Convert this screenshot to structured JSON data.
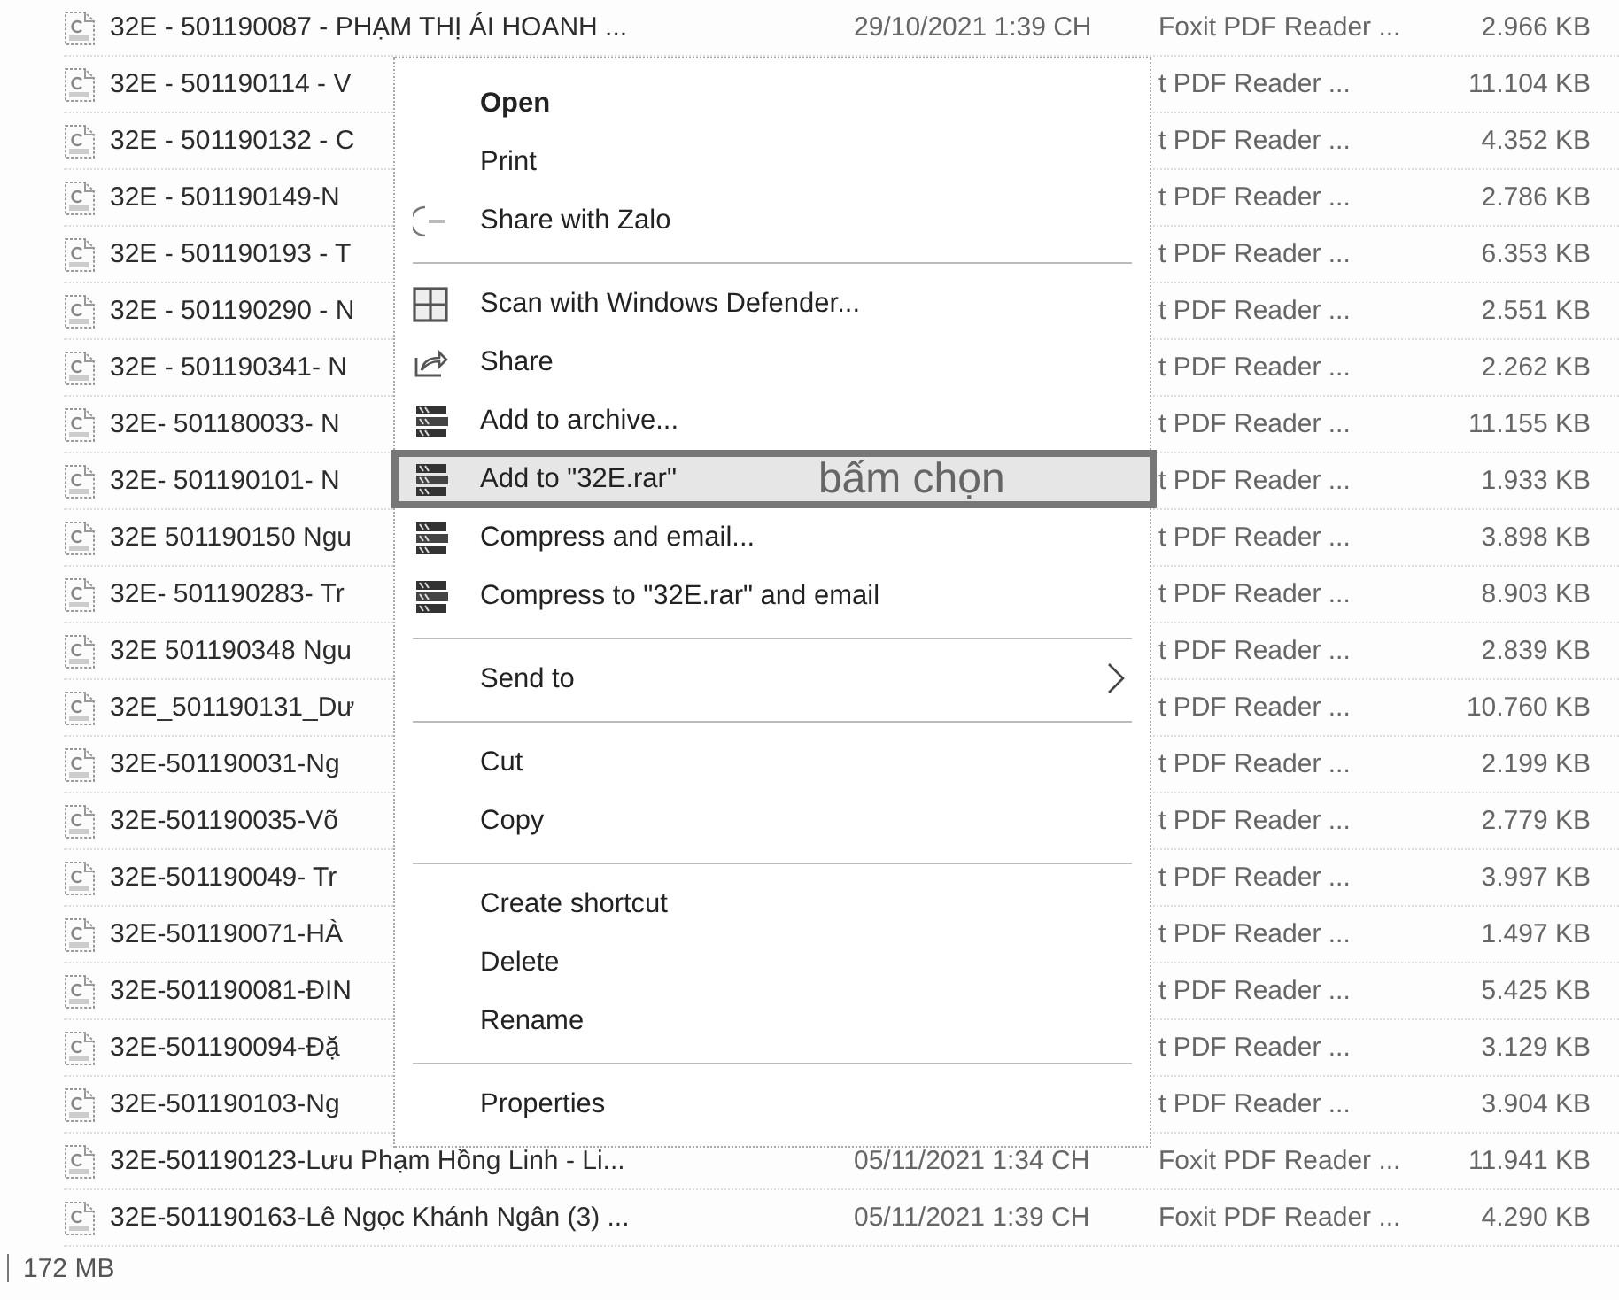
{
  "files": [
    {
      "name": "32E - 501190087 - PHẠM THỊ ÁI HOANH ...",
      "date": "29/10/2021 1:39 CH",
      "type": "Foxit PDF Reader ...",
      "size": "2.966 KB"
    },
    {
      "name": "32E - 501190114 - V",
      "type": "t PDF Reader ...",
      "size": "11.104 KB"
    },
    {
      "name": "32E - 501190132 - C",
      "type": "t PDF Reader ...",
      "size": "4.352 KB"
    },
    {
      "name": "32E - 501190149-N",
      "type": "t PDF Reader ...",
      "size": "2.786 KB"
    },
    {
      "name": "32E - 501190193 - T",
      "type": "t PDF Reader ...",
      "size": "6.353 KB"
    },
    {
      "name": "32E - 501190290 - N",
      "type": "t PDF Reader ...",
      "size": "2.551 KB"
    },
    {
      "name": "32E - 501190341- N",
      "type": "t PDF Reader ...",
      "size": "2.262 KB"
    },
    {
      "name": "32E- 501180033- N",
      "type": "t PDF Reader ...",
      "size": "11.155 KB"
    },
    {
      "name": "32E- 501190101- N",
      "type": "t PDF Reader ...",
      "size": "1.933 KB"
    },
    {
      "name": "32E 501190150 Ngu",
      "type": "t PDF Reader ...",
      "size": "3.898 KB"
    },
    {
      "name": "32E- 501190283- Tr",
      "type": "t PDF Reader ...",
      "size": "8.903 KB"
    },
    {
      "name": "32E 501190348 Ngu",
      "type": "t PDF Reader ...",
      "size": "2.839 KB"
    },
    {
      "name": "32E_501190131_Dư",
      "type": "t PDF Reader ...",
      "size": "10.760 KB"
    },
    {
      "name": "32E-501190031-Ng",
      "type": "t PDF Reader ...",
      "size": "2.199 KB"
    },
    {
      "name": "32E-501190035-Võ",
      "type": "t PDF Reader ...",
      "size": "2.779 KB"
    },
    {
      "name": "32E-501190049- Tr",
      "type": "t PDF Reader ...",
      "size": "3.997 KB"
    },
    {
      "name": "32E-501190071-HÀ",
      "type": "t PDF Reader ...",
      "size": "1.497 KB"
    },
    {
      "name": "32E-501190081-ĐIN",
      "type": "t PDF Reader ...",
      "size": "5.425 KB"
    },
    {
      "name": "32E-501190094-Đặ",
      "type": "t PDF Reader ...",
      "size": "3.129 KB"
    },
    {
      "name": "32E-501190103-Ng",
      "type": "t PDF Reader ...",
      "size": "3.904 KB"
    },
    {
      "name": "32E-501190123-Lưu Phạm Hồng Linh - Li...",
      "date": "05/11/2021 1:34 CH",
      "type": "Foxit PDF Reader ...",
      "size": "11.941 KB"
    },
    {
      "name": "32E-501190163-Lê Ngọc Khánh Ngân (3) ...",
      "date": "05/11/2021 1:39 CH",
      "type": "Foxit PDF Reader ...",
      "size": "4.290 KB"
    }
  ],
  "context_menu": [
    {
      "kind": "plain",
      "label": "Open",
      "default": true,
      "selected": false
    },
    {
      "kind": "plain",
      "label": "Print",
      "default": false,
      "selected": false
    },
    {
      "kind": "zalo",
      "label": "Share with Zalo",
      "selected": false
    },
    {
      "kind": "separator"
    },
    {
      "kind": "scan",
      "label": "Scan with Windows Defender...",
      "selected": false
    },
    {
      "kind": "share",
      "label": "Share",
      "selected": false
    },
    {
      "kind": "archive",
      "label": "Add to archive...",
      "selected": false
    },
    {
      "kind": "archive",
      "label": "Add to \"32E.rar\"",
      "selected": true,
      "note": "bấm chọn"
    },
    {
      "kind": "archive",
      "label": "Compress and email...",
      "selected": false
    },
    {
      "kind": "archive",
      "label": "Compress to \"32E.rar\" and email",
      "selected": false
    },
    {
      "kind": "separator"
    },
    {
      "kind": "submenu",
      "label": "Send to",
      "selected": false
    },
    {
      "kind": "separator"
    },
    {
      "kind": "plain",
      "label": "Cut",
      "selected": false
    },
    {
      "kind": "plain",
      "label": "Copy",
      "selected": false
    },
    {
      "kind": "separator"
    },
    {
      "kind": "plain",
      "label": "Create shortcut",
      "selected": false
    },
    {
      "kind": "plain",
      "label": "Delete",
      "selected": false
    },
    {
      "kind": "plain",
      "label": "Rename",
      "selected": false
    },
    {
      "kind": "separator"
    },
    {
      "kind": "plain",
      "label": "Properties",
      "selected": false
    }
  ],
  "status_bar": {
    "size": "172 MB"
  }
}
